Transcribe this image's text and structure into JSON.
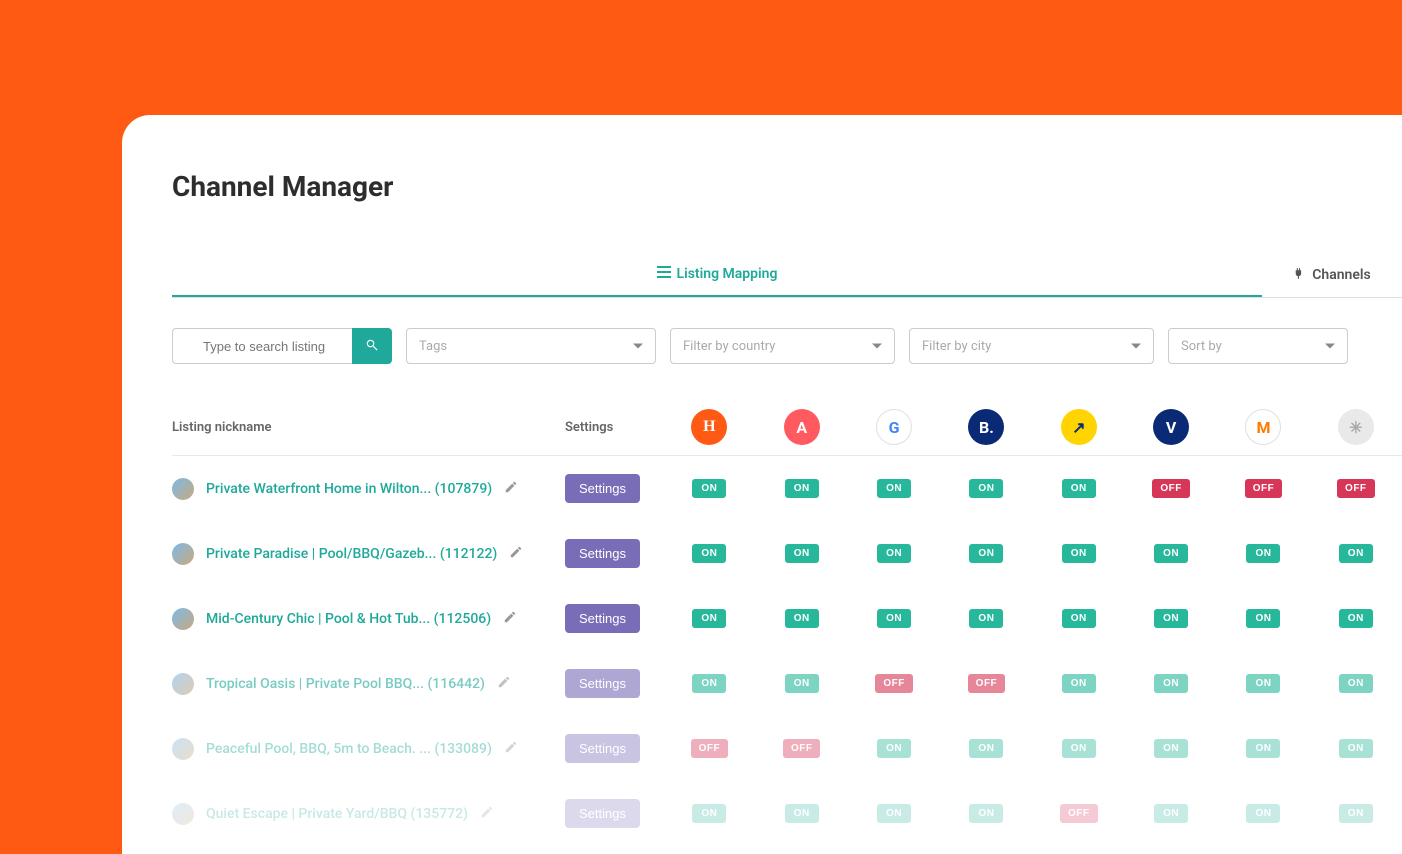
{
  "page_title": "Channel Manager",
  "tabs": {
    "listing_mapping": "Listing Mapping",
    "channels": "Channels"
  },
  "filters": {
    "search_placeholder": "Type to search listing",
    "tags": "Tags",
    "country": "Filter by country",
    "city": "Filter by city",
    "sort": "Sort by"
  },
  "headers": {
    "listing_nickname": "Listing nickname",
    "settings": "Settings"
  },
  "channels": [
    {
      "name": "hostfully",
      "bg": "#ff5a13",
      "fg": "#fff",
      "label": "H"
    },
    {
      "name": "airbnb",
      "bg": "#ff5a5f",
      "fg": "#fff",
      "label": "A"
    },
    {
      "name": "google",
      "bg": "#fff",
      "fg": "#4285f4",
      "label": "G"
    },
    {
      "name": "booking",
      "bg": "#0b2a75",
      "fg": "#fff",
      "label": "B."
    },
    {
      "name": "expedia",
      "bg": "#ffd400",
      "fg": "#0b2a75",
      "label": "↗"
    },
    {
      "name": "vrbo",
      "bg": "#0b2a75",
      "fg": "#fff",
      "label": "V"
    },
    {
      "name": "marriott",
      "bg": "#fff",
      "fg": "#ff7a00",
      "label": "M"
    },
    {
      "name": "other",
      "bg": "#e9e9e9",
      "fg": "#aaa",
      "label": "✳"
    }
  ],
  "buttons": {
    "settings": "Settings"
  },
  "toggle_labels": {
    "on": "ON",
    "off": "OFF"
  },
  "listings": [
    {
      "name": "Private Waterfront Home in Wilton... (107879)",
      "fade": "",
      "states": [
        "ON",
        "ON",
        "ON",
        "ON",
        "ON",
        "OFF",
        "OFF",
        "OFF"
      ]
    },
    {
      "name": "Private Paradise | Pool/BBQ/Gazeb... (112122)",
      "fade": "",
      "states": [
        "ON",
        "ON",
        "ON",
        "ON",
        "ON",
        "ON",
        "ON",
        "ON"
      ]
    },
    {
      "name": "Mid-Century Chic | Pool & Hot Tub... (112506)",
      "fade": "",
      "states": [
        "ON",
        "ON",
        "ON",
        "ON",
        "ON",
        "ON",
        "ON",
        "ON"
      ]
    },
    {
      "name": "Tropical Oasis | Private Pool BBQ... (116442)",
      "fade": "fade-1",
      "states": [
        "ON",
        "ON",
        "OFF",
        "OFF",
        "ON",
        "ON",
        "ON",
        "ON"
      ]
    },
    {
      "name": "Peaceful Pool, BBQ, 5m to Beach. ... (133089)",
      "fade": "fade-2",
      "states": [
        "OFF",
        "OFF",
        "ON",
        "ON",
        "ON",
        "ON",
        "ON",
        "ON"
      ]
    },
    {
      "name": "Quiet Escape | Private Yard/BBQ (135772)",
      "fade": "fade-3",
      "states": [
        "ON",
        "ON",
        "ON",
        "ON",
        "OFF",
        "ON",
        "ON",
        "ON"
      ]
    }
  ]
}
